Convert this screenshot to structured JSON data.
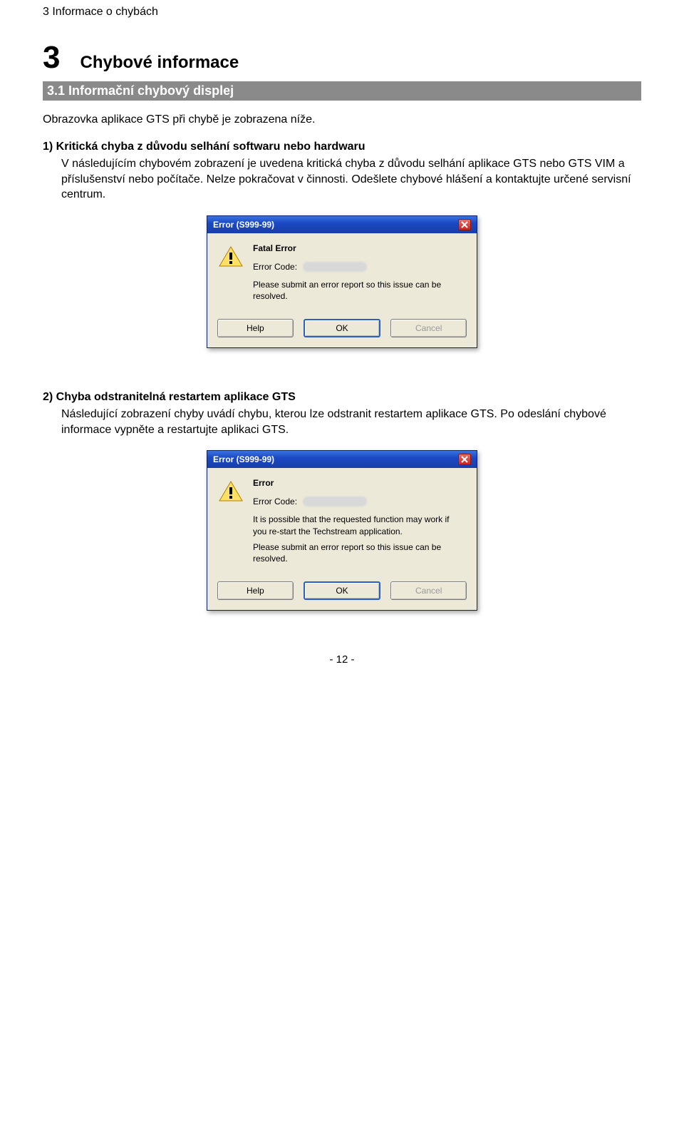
{
  "running_header": "3 Informace o chybách",
  "chapter_number": "3",
  "chapter_title": "Chybové informace",
  "section_heading": "3.1   Informační chybový displej",
  "intro_text": "Obrazovka aplikace GTS při chybě je zobrazena níže.",
  "item1": {
    "heading": "1)   Kritická chyba z důvodu selhání softwaru nebo hardwaru",
    "body": "V následujícím chybovém zobrazení je uvedena kritická chyba z důvodu selhání aplikace GTS nebo GTS VIM a příslušenství nebo počítače. Nelze pokračovat v činnosti. Odešlete chybové hlášení a kontaktujte určené servisní centrum."
  },
  "item2": {
    "heading": "2)   Chyba odstranitelná restartem aplikace GTS",
    "body": "Následující zobrazení chyby uvádí chybu, kterou lze odstranit restartem aplikace GTS. Po odeslání chybové informace vypněte a restartujte aplikaci GTS."
  },
  "dialog1": {
    "title": "Error (S999-99)",
    "heading": "Fatal Error",
    "error_code_label": "Error Code:",
    "msg1": "Please submit an error report so this issue can be resolved.",
    "buttons": {
      "help": "Help",
      "ok": "OK",
      "cancel": "Cancel"
    }
  },
  "dialog2": {
    "title": "Error (S999-99)",
    "heading": "Error",
    "error_code_label": "Error Code:",
    "msg1": "It is possible that the requested function may work if you re-start the Techstream application.",
    "msg2": "Please submit an error report so this issue can be resolved.",
    "buttons": {
      "help": "Help",
      "ok": "OK",
      "cancel": "Cancel"
    }
  },
  "page_number": "- 12 -"
}
